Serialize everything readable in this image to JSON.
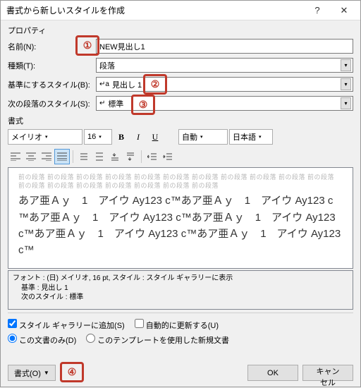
{
  "title": "書式から新しいスタイルを作成",
  "properties": {
    "section": "プロパティ",
    "name_label": "名前(N):",
    "name_value": "NEW見出し1",
    "type_label": "種類(T):",
    "type_value": "段落",
    "base_label": "基準にするスタイル(B):",
    "base_value": "見出し 1",
    "base_icon": "↵a",
    "next_label": "次の段落のスタイル(S):",
    "next_value": "標準",
    "next_icon": "↵"
  },
  "format": {
    "section": "書式",
    "font_name": "メイリオ",
    "font_size": "16",
    "bold": "B",
    "italic": "I",
    "underline": "U",
    "color": "自動",
    "lang": "日本語"
  },
  "preview": {
    "gray_text": "前の段落 前の段落 前の段落 前の段落 前の段落 前の段落 前の段落 前の段落 前の段落 前の段落 前の段落 前の段落 前の段落 前の段落 前の段落 前の段落 前の段落 前の段落",
    "main_text": "あア亜Ａｙ　1　アイウ Ay123 c™あア亜Ａｙ　1　アイウ Ay123 c™あア亜Ａｙ　1　アイウ Ay123 c™あア亜Ａｙ　1　アイウ Ay123 c™あア亜Ａｙ　1　アイウ Ay123 c™あア亜Ａｙ　1　アイウ Ay123 c™"
  },
  "description": {
    "line1": "フォント : (日) メイリオ, 16 pt, スタイル : スタイル ギャラリーに表示",
    "line2": "基準 : 見出し 1",
    "line3": "次のスタイル : 標準"
  },
  "options": {
    "add_gallery": "スタイル ギャラリーに追加(S)",
    "auto_update": "自動的に更新する(U)",
    "doc_only": "この文書のみ(D)",
    "template": "このテンプレートを使用した新規文書"
  },
  "buttons": {
    "format": "書式(O)",
    "ok": "OK",
    "cancel": "キャンセル"
  },
  "callouts": {
    "c1": "①",
    "c2": "②",
    "c3": "③",
    "c4": "④"
  }
}
